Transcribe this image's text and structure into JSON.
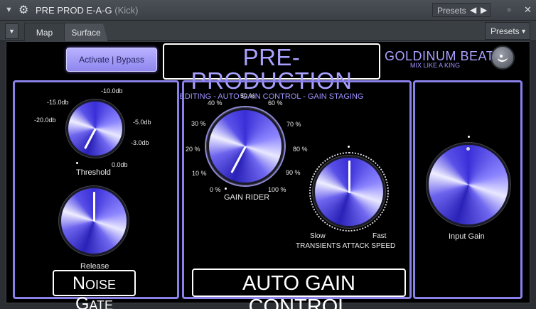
{
  "window": {
    "title": "PRE PROD E-A-G",
    "subtitle": "(Kick)",
    "presets_label": "Presets"
  },
  "toolbar": {
    "tabs": [
      "Map",
      "Surface"
    ],
    "active_tab": "Surface",
    "presets_dropdown": "Presets"
  },
  "plugin": {
    "activate_button": "Activate | Bypass",
    "header_title": "PRE-PRODUCTION",
    "header_subtitle": "EDITING - AUTO GAIN CONTROL - GAIN STAGING",
    "brand_name": "GOLDINUM BEATS",
    "brand_tagline": "MIX LIKE A KING",
    "accent_color": "#8a80ea"
  },
  "noise_gate": {
    "section_label": "Noise Gate",
    "threshold": {
      "caption": "Threshold",
      "scale": [
        "-20.0db",
        "-15.0db",
        "-10.0db",
        "-5.0db",
        "-3.0db",
        "0.0db"
      ]
    },
    "release": {
      "caption": "Release"
    }
  },
  "auto_gain_control": {
    "section_label": "AUTO GAIN CONTROL",
    "gain_rider": {
      "caption": "GAIN RIDER",
      "scale": [
        "0 %",
        "10 %",
        "20 %",
        "30 %",
        "40 %",
        "50 %",
        "60 %",
        "70 %",
        "80 %",
        "90 %",
        "100 %"
      ]
    },
    "transients": {
      "caption": "TRANSIENTS ATTACK SPEED",
      "min_label": "Slow",
      "max_label": "Fast"
    }
  },
  "input": {
    "caption": "Input Gain"
  }
}
